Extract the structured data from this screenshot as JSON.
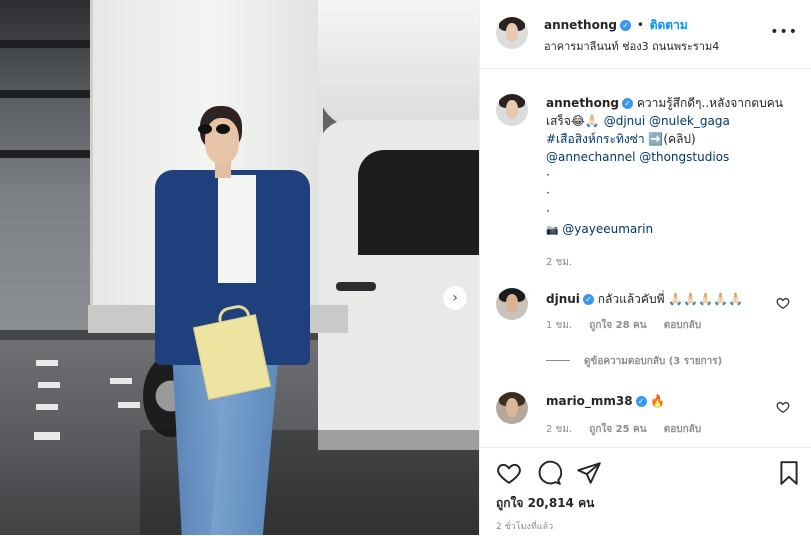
{
  "post_header": {
    "username": "annethong",
    "separator": "•",
    "follow_label": "ติดตาม",
    "location": "อาคารมาลีนนท์ ช่อง3 ถนนพระราม4"
  },
  "caption": {
    "username": "annethong",
    "text_1": "ความรู้สึกดีๆ..หลังจากตบคนเสร็จ😂🙏🏻",
    "mention_1": "@djnui",
    "mention_2": "@nulek_gaga",
    "hashtag": "#เสือสิงห์กระทิงซ่า",
    "text_2": "➡️(คลิป)",
    "mention_3": "@annechannel",
    "mention_4": "@thongstudios",
    "dots": [
      "·",
      "·",
      "·"
    ],
    "camera_icon": "📷",
    "photo_credit": "@yayeeumarin",
    "time": "2 ชม."
  },
  "comments": [
    {
      "username": "djnui",
      "text": "กลัวแล้วคับพี่ 🙏🏻🙏🏻🙏🏻🙏🏻🙏🏻",
      "time": "1 ชม.",
      "likes": "ถูกใจ 28 คน",
      "reply_label": "ตอบกลับ"
    },
    {
      "username": "mario_mm38",
      "text": "🔥",
      "time": "2 ชม.",
      "likes": "ถูกใจ 25 คน",
      "reply_label": "ตอบกลับ"
    }
  ],
  "view_replies": "ดูข้อความตอบกลับ (3 รายการ)",
  "footer": {
    "likes": "ถูกใจ 20,814 คน",
    "posted_ago": "2 ชั่วโมงที่แล้ว"
  },
  "icons": {
    "more": "•••",
    "next": "›",
    "verified": "✓"
  },
  "colors": {
    "link": "#00376b",
    "follow": "#0095f6",
    "verified": "#3897f0",
    "muted": "#8e8e8e",
    "jacket": "#1f3f7d"
  }
}
